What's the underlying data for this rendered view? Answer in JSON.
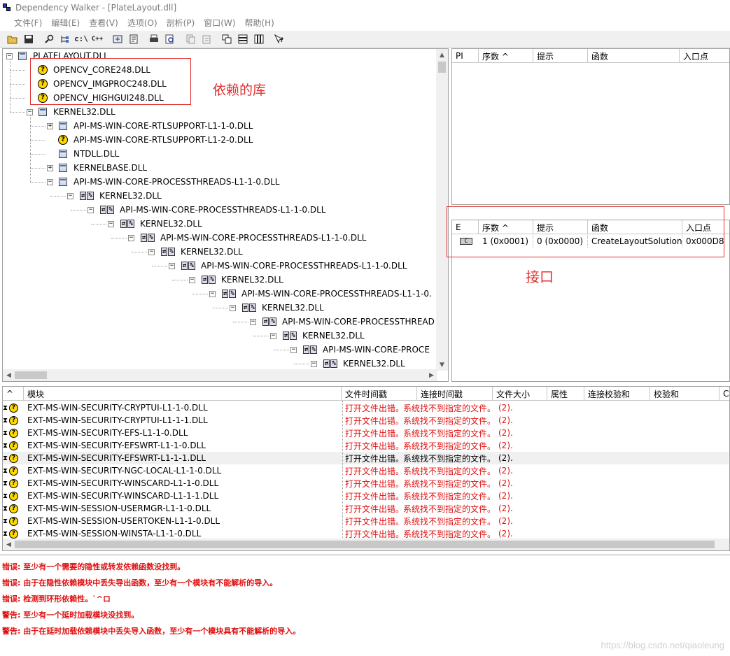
{
  "window": {
    "title": "Dependency Walker - [PlateLayout.dll]"
  },
  "menu": [
    "文件(F)",
    "编辑(E)",
    "查看(V)",
    "选项(O)",
    "剖析(P)",
    "窗口(W)",
    "帮助(H)"
  ],
  "toolbar": {
    "buttons": [
      "open-icon",
      "save-icon",
      "search-icon",
      "tree-icon",
      "c-path-icon",
      "cpp-icon",
      "expand-icon",
      "properties-icon",
      "print-icon",
      "find-icon",
      "copy-icon",
      "paste-icon",
      "tile-icon",
      "split-h-icon",
      "split-v-icon",
      "help-icon"
    ],
    "c_path_label": "c:\\",
    "cpp_label": "C++"
  },
  "tree": {
    "rows": [
      {
        "label": "PLATELAYOUT.DLL",
        "icon": "dll-icon",
        "expander": "-",
        "indent": 0
      },
      {
        "label": "OPENCV_CORE248.DLL",
        "icon": "missing-icon",
        "expander": "",
        "indent": 1
      },
      {
        "label": "OPENCV_IMGPROC248.DLL",
        "icon": "missing-icon",
        "expander": "",
        "indent": 1
      },
      {
        "label": "OPENCV_HIGHGUI248.DLL",
        "icon": "missing-icon",
        "expander": "",
        "indent": 1
      },
      {
        "label": "KERNEL32.DLL",
        "icon": "dll-icon",
        "expander": "-",
        "indent": 1
      },
      {
        "label": "API-MS-WIN-CORE-RTLSUPPORT-L1-1-0.DLL",
        "icon": "dll-icon",
        "expander": "+",
        "indent": 2
      },
      {
        "label": "API-MS-WIN-CORE-RTLSUPPORT-L1-2-0.DLL",
        "icon": "missing-icon",
        "expander": "",
        "indent": 2
      },
      {
        "label": "NTDLL.DLL",
        "icon": "dll-icon",
        "expander": "",
        "indent": 2
      },
      {
        "label": "KERNELBASE.DLL",
        "icon": "dll-icon",
        "expander": "+",
        "indent": 2
      },
      {
        "label": "API-MS-WIN-CORE-PROCESSTHREADS-L1-1-0.DLL",
        "icon": "dll-icon",
        "expander": "-",
        "indent": 2
      },
      {
        "label": "KERNEL32.DLL",
        "icon": "forward-icon",
        "expander": "-",
        "indent": 3
      },
      {
        "label": "API-MS-WIN-CORE-PROCESSTHREADS-L1-1-0.DLL",
        "icon": "forward-icon",
        "expander": "-",
        "indent": 4
      },
      {
        "label": "KERNEL32.DLL",
        "icon": "forward-icon",
        "expander": "-",
        "indent": 5
      },
      {
        "label": "API-MS-WIN-CORE-PROCESSTHREADS-L1-1-0.DLL",
        "icon": "forward-icon",
        "expander": "-",
        "indent": 6
      },
      {
        "label": "KERNEL32.DLL",
        "icon": "forward-icon",
        "expander": "-",
        "indent": 7
      },
      {
        "label": "API-MS-WIN-CORE-PROCESSTHREADS-L1-1-0.DLL",
        "icon": "forward-icon",
        "expander": "-",
        "indent": 8
      },
      {
        "label": "KERNEL32.DLL",
        "icon": "forward-icon",
        "expander": "-",
        "indent": 9
      },
      {
        "label": "API-MS-WIN-CORE-PROCESSTHREADS-L1-1-0.",
        "icon": "forward-icon",
        "expander": "-",
        "indent": 10
      },
      {
        "label": "KERNEL32.DLL",
        "icon": "forward-icon",
        "expander": "-",
        "indent": 11
      },
      {
        "label": "API-MS-WIN-CORE-PROCESSTHREAD",
        "icon": "forward-icon",
        "expander": "-",
        "indent": 12
      },
      {
        "label": "KERNEL32.DLL",
        "icon": "forward-icon",
        "expander": "-",
        "indent": 13
      },
      {
        "label": "API-MS-WIN-CORE-PROCE",
        "icon": "forward-icon",
        "expander": "-",
        "indent": 14
      },
      {
        "label": "KERNEL32.DLL",
        "icon": "forward-icon",
        "expander": "-",
        "indent": 15
      }
    ]
  },
  "annotations": {
    "dependencies": "依赖的库",
    "interface": "接口"
  },
  "imports_pane": {
    "columns": [
      "PI",
      "序数 ^",
      "提示",
      "函数",
      "入口点"
    ]
  },
  "exports_pane": {
    "columns": [
      "E",
      "序数 ^",
      "提示",
      "函数",
      "入口点"
    ],
    "rows": [
      {
        "icon": "c-function-icon",
        "icon_text": "C",
        "ordinal": "1 (0x0001)",
        "hint": "0 (0x0000)",
        "function": "CreateLayoutSolution",
        "entry": "0x000D8"
      }
    ]
  },
  "modules_pane": {
    "columns": [
      "^",
      "模块",
      "文件时间戳",
      "连接时间戳",
      "文件大小",
      "属性",
      "连接校验和",
      "校验和",
      "CPU"
    ],
    "rows": [
      {
        "module": "EXT-MS-WIN-SECURITY-CRYPTUI-L1-1-0.DLL",
        "err1": "打开文件出错。",
        "err2": "系统找不到指定的文件。",
        "code": "(2).",
        "selected": false
      },
      {
        "module": "EXT-MS-WIN-SECURITY-CRYPTUI-L1-1-1.DLL",
        "err1": "打开文件出错。",
        "err2": "系统找不到指定的文件。",
        "code": "(2).",
        "selected": false
      },
      {
        "module": "EXT-MS-WIN-SECURITY-EFS-L1-1-0.DLL",
        "err1": "打开文件出错。",
        "err2": "系统找不到指定的文件。",
        "code": "(2).",
        "selected": false
      },
      {
        "module": "EXT-MS-WIN-SECURITY-EFSWRT-L1-1-0.DLL",
        "err1": "打开文件出错。",
        "err2": "系统找不到指定的文件。",
        "code": "(2).",
        "selected": false
      },
      {
        "module": "EXT-MS-WIN-SECURITY-EFSWRT-L1-1-1.DLL",
        "err1": "打开文件出错。",
        "err2": "系统找不到指定的文件。",
        "code": "(2).",
        "selected": true
      },
      {
        "module": "EXT-MS-WIN-SECURITY-NGC-LOCAL-L1-1-0.DLL",
        "err1": "打开文件出错。",
        "err2": "系统找不到指定的文件。",
        "code": "(2).",
        "selected": false
      },
      {
        "module": "EXT-MS-WIN-SECURITY-WINSCARD-L1-1-0.DLL",
        "err1": "打开文件出错。",
        "err2": "系统找不到指定的文件。",
        "code": "(2).",
        "selected": false
      },
      {
        "module": "EXT-MS-WIN-SECURITY-WINSCARD-L1-1-1.DLL",
        "err1": "打开文件出错。",
        "err2": "系统找不到指定的文件。",
        "code": "(2).",
        "selected": false
      },
      {
        "module": "EXT-MS-WIN-SESSION-USERMGR-L1-1-0.DLL",
        "err1": "打开文件出错。",
        "err2": "系统找不到指定的文件。",
        "code": "(2).",
        "selected": false
      },
      {
        "module": "EXT-MS-WIN-SESSION-USERTOKEN-L1-1-0.DLL",
        "err1": "打开文件出错。",
        "err2": "系统找不到指定的文件。",
        "code": "(2).",
        "selected": false
      },
      {
        "module": "EXT-MS-WIN-SESSION-WINSTA-L1-1-0.DLL",
        "err1": "打开文件出错。",
        "err2": "系统找不到指定的文件。",
        "code": "(2).",
        "selected": false
      }
    ]
  },
  "log": [
    "错误: 至少有一个需要的隐性或转发依赖函数没找到。",
    "错误: 由于在隐性依赖模块中丢失导出函数，至少有一个模块有不能解析的导入。",
    "错误: 检测到环形依赖性。`^ロ",
    "警告: 至少有一个延时加载模块没找到。",
    "警告: 由于在延时加载依赖模块中丢失导入函数，至少有一个模块具有不能解析的导入。"
  ],
  "watermark": "https://blog.csdn.net/qiaoleung",
  "colors": {
    "annotation_red": "#e03030",
    "error_red": "#e01010"
  }
}
